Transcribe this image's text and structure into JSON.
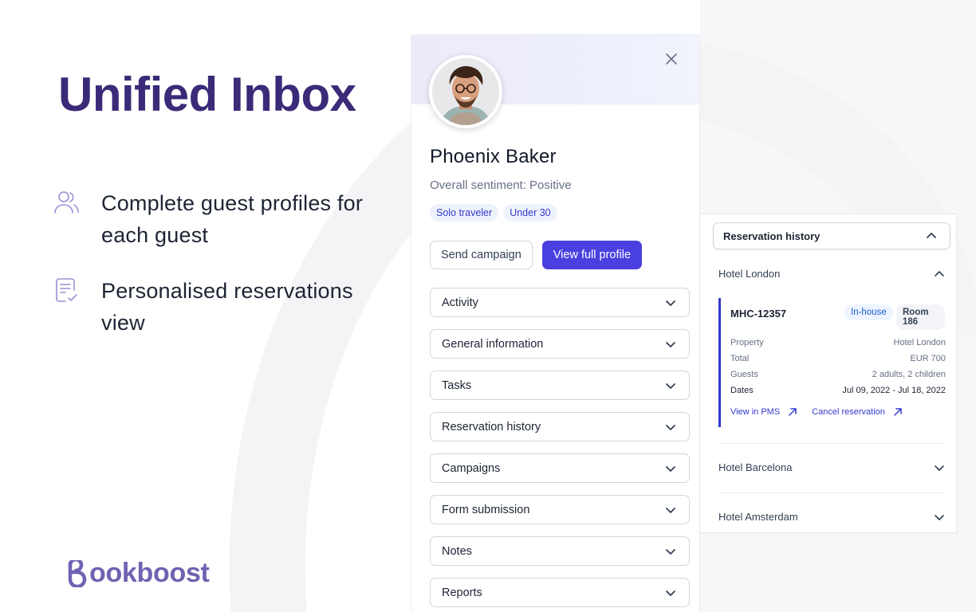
{
  "hero": {
    "title": "Unified Inbox",
    "features": [
      {
        "icon": "users-icon",
        "text": "Complete guest profiles for each guest"
      },
      {
        "icon": "document-check-icon",
        "text": "Personalised reservations view"
      }
    ]
  },
  "brand": {
    "logo_text": "ookboost",
    "logo_initial": "B",
    "color": "#7161b2"
  },
  "profile": {
    "name": "Phoenix Baker",
    "sentiment": "Overall sentiment: Positive",
    "tags": [
      "Solo traveler",
      "Under 30"
    ],
    "actions": {
      "send_campaign": "Send campaign",
      "view_full_profile": "View full profile"
    },
    "sections": [
      "Activity",
      "General information",
      "Tasks",
      "Reservation history",
      "Campaigns",
      "Form submission",
      "Notes",
      "Reports"
    ]
  },
  "reservation_history": {
    "header": "Reservation history",
    "hotels": [
      {
        "name": "Hotel London",
        "expanded": true
      },
      {
        "name": "Hotel Barcelona",
        "expanded": false
      },
      {
        "name": "Hotel Amsterdam",
        "expanded": false
      }
    ],
    "reservation": {
      "code": "MHC-12357",
      "status": "In-house",
      "room": "Room 186",
      "details": [
        {
          "label": "Property",
          "value": "Hotel London"
        },
        {
          "label": "Total",
          "value": "EUR 700"
        },
        {
          "label": "Guests",
          "value": "2 adults, 2 children"
        },
        {
          "label": "Dates",
          "value": "Jul 09, 2022 - Jul 18, 2022"
        }
      ],
      "links": {
        "view_in_pms": "View in PMS",
        "cancel": "Cancel reservation"
      }
    }
  },
  "colors": {
    "accent": "#4a40e0",
    "title": "#3b2a78",
    "link": "#3538cd"
  }
}
